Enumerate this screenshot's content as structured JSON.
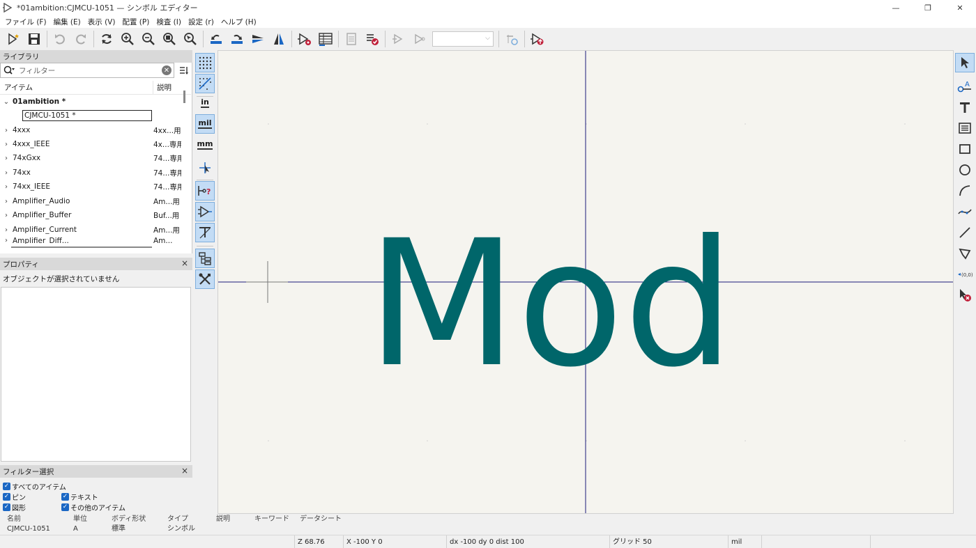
{
  "window": {
    "title": "*01ambition:CJMCU-1051 — シンボル エディター",
    "minimize": "—",
    "restore": "❐",
    "close": "✕"
  },
  "menu": [
    "ファイル (F)",
    "編集 (E)",
    "表示 (V)",
    "配置 (P)",
    "検査 (I)",
    "設定 (r)",
    "ヘルプ (H)"
  ],
  "library": {
    "header": "ライブラリ",
    "search_placeholder": "フィルター",
    "col_item": "アイテム",
    "col_desc": "説明",
    "root": {
      "name": "01ambition *",
      "chevron": "⌄"
    },
    "editing": "CJMCU-1051 *",
    "rows": [
      {
        "name": "4xxx",
        "desc": "4xx...用"
      },
      {
        "name": "4xxx_IEEE",
        "desc": "4x...専用"
      },
      {
        "name": "74xGxx",
        "desc": "74...専用"
      },
      {
        "name": "74xx",
        "desc": "74...専用"
      },
      {
        "name": "74xx_IEEE",
        "desc": "74...専用"
      },
      {
        "name": "Amplifier_Audio",
        "desc": "Am...用"
      },
      {
        "name": "Amplifier_Buffer",
        "desc": "Buf...用"
      },
      {
        "name": "Amplifier_Current",
        "desc": "Am...用"
      },
      {
        "name": "Amplifier_Diff...",
        "desc": "Am..."
      }
    ]
  },
  "properties": {
    "header": "プロパティ",
    "message": "オブジェクトが選択されていません"
  },
  "filter": {
    "header": "フィルター選択",
    "items": [
      "すべてのアイテム",
      "ピン",
      "テキスト",
      "図形",
      "その他のアイテム"
    ]
  },
  "units": {
    "in": "in",
    "mil": "mil",
    "mm": "mm"
  },
  "canvas": {
    "text": "Mod",
    "text_color": "#00666a",
    "crosshair_color": "#1a1a7a",
    "bg": "#f5f4ef"
  },
  "info": [
    {
      "k": "名前",
      "v": "CJMCU-1051"
    },
    {
      "k": "単位",
      "v": "A"
    },
    {
      "k": "ボディ形状",
      "v": "標準"
    },
    {
      "k": "タイプ",
      "v": "シンボル"
    },
    {
      "k": "説明",
      "v": ""
    },
    {
      "k": "キーワード",
      "v": ""
    },
    {
      "k": "データシート",
      "v": ""
    }
  ],
  "status": {
    "zoom": "Z 68.76",
    "xy": "X -100  Y 0",
    "delta": "dx -100  dy 0  dist 100",
    "grid": "グリッド 50",
    "unit": "mil"
  }
}
